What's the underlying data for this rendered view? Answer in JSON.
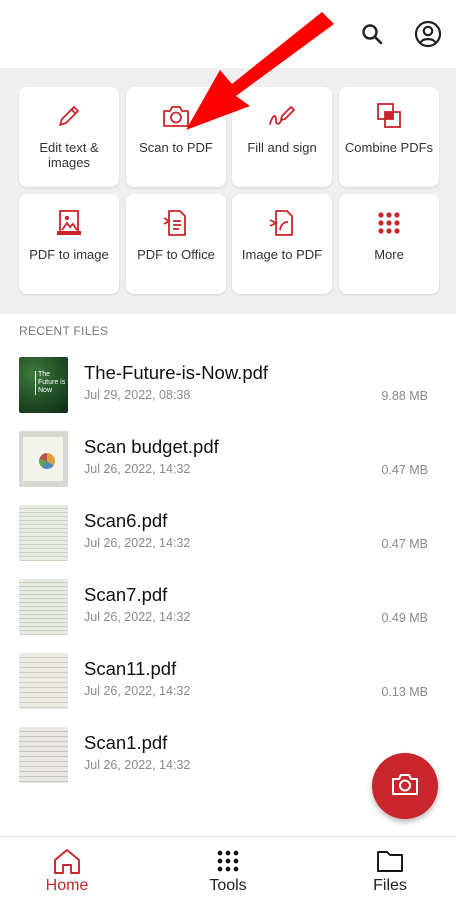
{
  "header": {
    "search_icon": "search-icon",
    "account_icon": "account-circle-icon"
  },
  "tools": [
    {
      "label": "Edit text & images",
      "icon": "pencil-icon"
    },
    {
      "label": "Scan to PDF",
      "icon": "camera-icon"
    },
    {
      "label": "Fill and sign",
      "icon": "sign-pen-icon"
    },
    {
      "label": "Combine PDFs",
      "icon": "combine-icon"
    },
    {
      "label": "PDF to image",
      "icon": "pdf-image-icon"
    },
    {
      "label": "PDF to Office",
      "icon": "pdf-office-icon"
    },
    {
      "label": "Image to PDF",
      "icon": "image-pdf-icon"
    },
    {
      "label": "More",
      "icon": "grid-dots-icon"
    }
  ],
  "recent": {
    "title": "RECENT FILES",
    "files": [
      {
        "name": "The-Future-is-Now.pdf",
        "date": "Jul 29, 2022, 08:38",
        "size": "9.88 MB",
        "thumb_text": "The Future is Now"
      },
      {
        "name": "Scan budget.pdf",
        "date": "Jul 26, 2022, 14:32",
        "size": "0.47 MB"
      },
      {
        "name": "Scan6.pdf",
        "date": "Jul 26, 2022, 14:32",
        "size": "0.47 MB"
      },
      {
        "name": "Scan7.pdf",
        "date": "Jul 26, 2022, 14:32",
        "size": "0.49 MB"
      },
      {
        "name": "Scan11.pdf",
        "date": "Jul 26, 2022, 14:32",
        "size": "0.13 MB"
      },
      {
        "name": "Scan1.pdf",
        "date": "Jul 26, 2022, 14:32",
        "size": ""
      }
    ]
  },
  "fab": {
    "icon": "camera-icon"
  },
  "nav": {
    "items": [
      {
        "label": "Home",
        "icon": "home-icon",
        "active": true
      },
      {
        "label": "Tools",
        "icon": "grid-dots-icon",
        "active": false
      },
      {
        "label": "Files",
        "icon": "folder-icon",
        "active": false
      }
    ]
  },
  "colors": {
    "accent": "#c8262c",
    "annotation_arrow": "#ff0000",
    "tools_background": "#efefef"
  }
}
